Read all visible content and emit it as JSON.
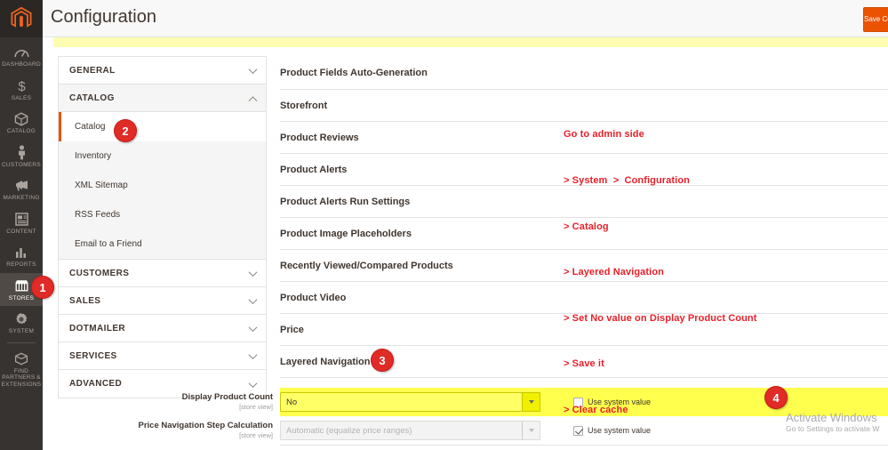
{
  "header": {
    "title": "Configuration",
    "save_label": "Save Config",
    "logo_icon": "magento-logo-icon"
  },
  "admin_nav": [
    {
      "label": "DASHBOARD",
      "icon": "dashboard-gauge-icon"
    },
    {
      "label": "SALES",
      "icon": "dollar-sign-icon"
    },
    {
      "label": "CATALOG",
      "icon": "box-icon"
    },
    {
      "label": "CUSTOMERS",
      "icon": "person-icon"
    },
    {
      "label": "MARKETING",
      "icon": "megaphone-icon"
    },
    {
      "label": "CONTENT",
      "icon": "layout-page-icon"
    },
    {
      "label": "REPORTS",
      "icon": "bar-chart-icon"
    },
    {
      "label": "STORES",
      "icon": "storefront-icon"
    },
    {
      "label": "SYSTEM",
      "icon": "gear-icon"
    },
    {
      "label": "FIND PARTNERS & EXTENSIONS",
      "icon": "package-icon"
    }
  ],
  "config_panel": {
    "sections": [
      {
        "name": "GENERAL",
        "state": "collapsed",
        "chevron": "chevron-down-icon"
      },
      {
        "name": "CATALOG",
        "state": "expanded",
        "chevron": "chevron-up-icon"
      },
      {
        "name": "CUSTOMERS",
        "state": "collapsed",
        "chevron": "chevron-down-icon"
      },
      {
        "name": "SALES",
        "state": "collapsed",
        "chevron": "chevron-down-icon"
      },
      {
        "name": "DOTMAILER",
        "state": "collapsed",
        "chevron": "chevron-down-icon"
      },
      {
        "name": "SERVICES",
        "state": "collapsed",
        "chevron": "chevron-down-icon"
      },
      {
        "name": "ADVANCED",
        "state": "collapsed",
        "chevron": "chevron-down-icon"
      }
    ],
    "catalog_items": [
      {
        "label": "Catalog",
        "selected": true
      },
      {
        "label": "Inventory",
        "selected": false
      },
      {
        "label": "XML Sitemap",
        "selected": false
      },
      {
        "label": "RSS Feeds",
        "selected": false
      },
      {
        "label": "Email to a Friend",
        "selected": false
      }
    ]
  },
  "main_sections": [
    {
      "title": "Product Fields Auto-Generation"
    },
    {
      "title": "Storefront"
    },
    {
      "title": "Product Reviews"
    },
    {
      "title": "Product Alerts"
    },
    {
      "title": "Product Alerts Run Settings"
    },
    {
      "title": "Product Image Placeholders"
    },
    {
      "title": "Recently Viewed/Compared Products"
    },
    {
      "title": "Product Video"
    },
    {
      "title": "Price"
    },
    {
      "title": "Layered Navigation"
    }
  ],
  "badges": [
    {
      "number": "1",
      "target": "sidebar-stores"
    },
    {
      "number": "2",
      "target": "catalog-subitem"
    },
    {
      "number": "3",
      "target": "layered-navigation-section"
    },
    {
      "number": "4",
      "target": "display-product-count-field"
    }
  ],
  "annotation": {
    "lines": [
      "Go to admin side",
      "> System  >  Configuration",
      "> Catalog",
      "> Layered Navigation",
      "> Set No value on Display Product Count",
      "> Save it",
      "> Clear cache"
    ],
    "color": "#e8202a"
  },
  "form": {
    "fields": [
      {
        "label": "Display Product Count",
        "scope": "[store view]",
        "value": "No",
        "highlighted": true,
        "disabled": false,
        "use_system_value_label": "Use system value",
        "use_system_value_checked": false
      },
      {
        "label": "Price Navigation Step Calculation",
        "scope": "[store view]",
        "value": "Automatic (equalize price ranges)",
        "highlighted": false,
        "disabled": true,
        "use_system_value_label": "Use system value",
        "use_system_value_checked": true
      }
    ]
  },
  "watermark": {
    "line1": "Activate Windows",
    "line2": "Go to Settings to activate W"
  },
  "colors": {
    "accent_orange": "#eb5202",
    "badge_red": "#e02b27",
    "annotation_red": "#e8202a",
    "highlight_yellow": "#ffff4d",
    "sidebar_dark": "#373330"
  }
}
